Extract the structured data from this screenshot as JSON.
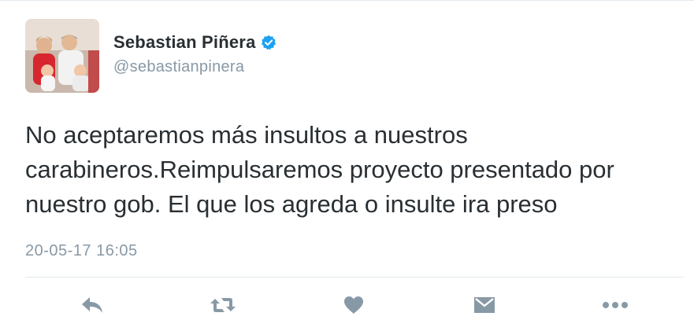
{
  "tweet": {
    "author": {
      "name": "Sebastian Piñera",
      "handle": "@sebastianpinera",
      "verified": true
    },
    "text": "No aceptaremos más insultos a nuestros\ncarabineros.Reimpulsaremos proyecto presentado por\nnuestro gob. El que los agreda o insulte ira preso",
    "timestamp": "20-05-17 16:05"
  },
  "actions": [
    {
      "icon": "reply-icon"
    },
    {
      "icon": "retweet-icon"
    },
    {
      "icon": "like-heart-icon"
    },
    {
      "icon": "direct-message-icon"
    },
    {
      "icon": "more-options-icon"
    }
  ],
  "colors": {
    "text": "#292f33",
    "secondary": "#8899a6",
    "verified_badge": "#1da1f2",
    "icon": "#8899a6",
    "divider": "#e1e8ed"
  }
}
